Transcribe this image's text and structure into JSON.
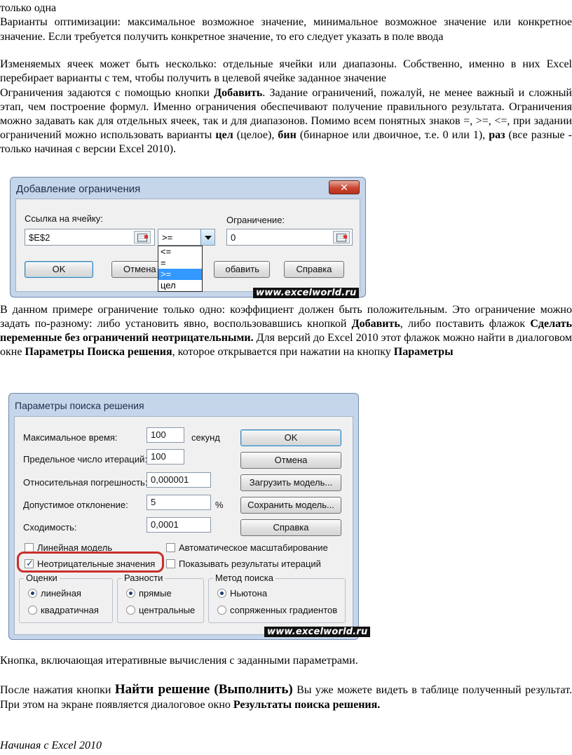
{
  "doc": {
    "line_top": "только одна",
    "para1": "Варианты оптимизации: максимальное возможное значение, минимальное возможное значение или конкретное значение. Если требуется получить конкретное значение, то его следует указать в поле ввода",
    "para2": "Изменяемых ячеек может быть несколько: отдельные ячейки или диапазоны. Собственно, именно в них Excel перебирает варианты с тем, чтобы получить в целевой ячейке заданное значение",
    "para3_a": "Ограничения задаются с помощью кнопки ",
    "para3_b": "Добавить",
    "para3_c": ". Задание ограничений, пожалуй, не менее важный и сложный этап, чем построение формул. Именно ограничения обеспечивают получение правильного результата. Ограничения можно задавать как для отдельных ячеек, так и для диапазонов. Помимо всем понятных знаков =, >=, <=, при задании ограничений можно использовать варианты ",
    "para3_d": "цел",
    "para3_e": " (целое), ",
    "para3_f": "бин",
    "para3_g": " (бинарное или двоичное, т.е. 0 или 1), ",
    "para3_h": "раз",
    "para3_i": " (все разные - только начиная с версии Excel 2010).",
    "para4_a": "В данном примере ограничение только одно: коэффициент должен быть положительным. Это ограничение можно задать по-разному: либо установить явно, воспользовавшись кнопкой ",
    "para4_b": "Добавить",
    "para4_c": ", либо поставить флажок ",
    "para4_d": "Сделать переменные без ограничений неотрицательными.",
    "para4_e": " Для версий до Excel 2010 этот флажок можно найти в диалоговом окне ",
    "para4_f": "Параметры Поиска решения",
    "para4_g": ", которое открывается при нажатии на кнопку ",
    "para4_h": "Параметры",
    "para5": "Кнопка, включающая итеративные вычисления с заданными параметрами.",
    "para6_a": "После нажатия кнопки ",
    "para6_b": "Найти решение (Выполнить)",
    "para6_c": " Вы уже можете видеть в таблице полученный результат. При этом на экране появляется диалоговое окно ",
    "para6_d": "Результаты поиска решения.",
    "footer_italic": "Начиная с Excel 2010"
  },
  "dialog_constraint": {
    "title": "Добавление ограничения",
    "close": "✕",
    "cell_ref_label": "Ссылка на ячейку:",
    "cell_ref_value": "$E$2",
    "operator_value": ">=",
    "constraint_label": "Ограничение:",
    "constraint_value": "0",
    "dropdown": [
      "<=",
      "=",
      ">=",
      "цел"
    ],
    "ok": "OK",
    "cancel": "Отмена",
    "add": "Добавить",
    "add_visible": "обавить",
    "help": "Справка",
    "watermark": "www.excelworld.ru"
  },
  "dialog_params": {
    "title": "Параметры поиска решения",
    "max_time_label": "Максимальное время:",
    "max_time_value": "100",
    "max_time_unit": "секунд",
    "iter_label": "Предельное число итераций:",
    "iter_value": "100",
    "precision_label": "Относительная погрешность:",
    "precision_value": "0,000001",
    "tolerance_label": "Допустимое отклонение:",
    "tolerance_value": "5",
    "tolerance_unit": "%",
    "convergence_label": "Сходимость:",
    "convergence_value": "0,0001",
    "ok": "OK",
    "cancel": "Отмена",
    "load": "Загрузить модель...",
    "save": "Сохранить модель...",
    "help": "Справка",
    "linear_model": "Линейная модель",
    "nonneg": "Неотрицательные значения",
    "autoscale": "Автоматическое масштабирование",
    "show_iter": "Показывать результаты итераций",
    "group_estimates": "Оценки",
    "est_linear": "линейная",
    "est_quadratic": "квадратичная",
    "group_diffs": "Разности",
    "diff_forward": "прямые",
    "diff_central": "центральные",
    "group_method": "Метод поиска",
    "method_newton": "Ньютона",
    "method_cg": "сопряженных градиентов",
    "watermark": "www.excelworld.ru"
  }
}
